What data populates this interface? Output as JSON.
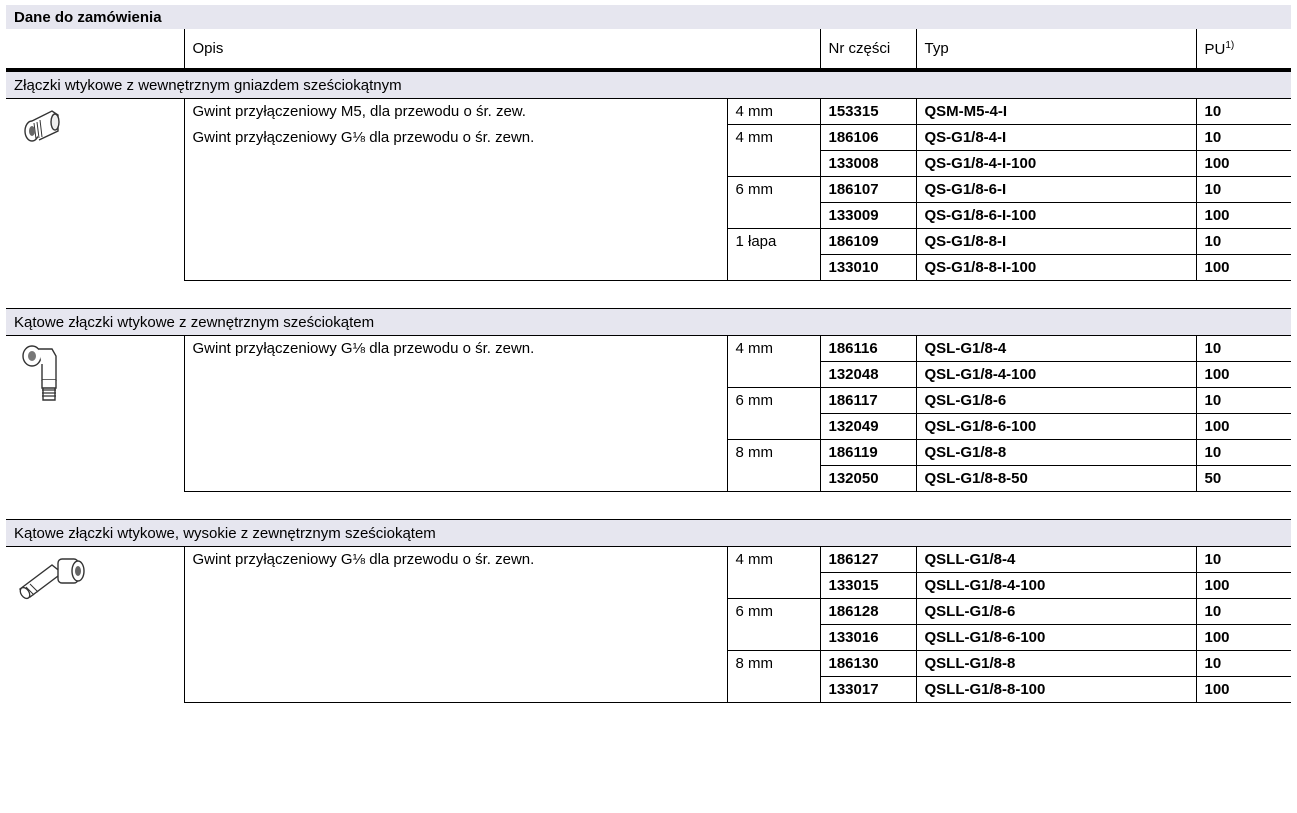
{
  "title": "Dane do zamówienia",
  "headers": {
    "opis": "Opis",
    "nr_czesci": "Nr części",
    "typ": "Typ",
    "pu": "PU",
    "pu_sup": "1)"
  },
  "sections": [
    {
      "name": "Złączki wtykowe z wewnętrznym gniazdem sześciokątnym",
      "icon": "straight-fitting-icon",
      "rows": [
        {
          "desc": "Gwint przyłączeniowy M5, dla przewodu o śr. zew.",
          "size": "4 mm",
          "part": "153315",
          "type": "QSM-M5-4-I",
          "pu": "10"
        },
        {
          "desc": "Gwint przyłączeniowy G⅛ dla przewodu o śr. zewn.",
          "size": "4 mm",
          "part": "186106",
          "type": "QS-G1/8-4-I",
          "pu": "10"
        },
        {
          "desc": "",
          "size": "",
          "part": "133008",
          "type": "QS-G1/8-4-I-100",
          "pu": "100"
        },
        {
          "desc": "",
          "size": "6 mm",
          "part": "186107",
          "type": "QS-G1/8-6-I",
          "pu": "10"
        },
        {
          "desc": "",
          "size": "",
          "part": "133009",
          "type": "QS-G1/8-6-I-100",
          "pu": "100"
        },
        {
          "desc": "",
          "size": "1 łapa",
          "part": "186109",
          "type": "QS-G1/8-8-I",
          "pu": "10"
        },
        {
          "desc": "",
          "size": "",
          "part": "133010",
          "type": "QS-G1/8-8-I-100",
          "pu": "100"
        }
      ]
    },
    {
      "name": "Kątowe złączki wtykowe z zewnętrznym sześciokątem",
      "icon": "elbow-fitting-icon",
      "rows": [
        {
          "desc": "Gwint przyłączeniowy G⅛ dla przewodu o śr. zewn.",
          "size": "4 mm",
          "part": "186116",
          "type": "QSL-G1/8-4",
          "pu": "10"
        },
        {
          "desc": "",
          "size": "",
          "part": "132048",
          "type": "QSL-G1/8-4-100",
          "pu": "100"
        },
        {
          "desc": "",
          "size": "6 mm",
          "part": "186117",
          "type": "QSL-G1/8-6",
          "pu": "10"
        },
        {
          "desc": "",
          "size": "",
          "part": "132049",
          "type": "QSL-G1/8-6-100",
          "pu": "100"
        },
        {
          "desc": "",
          "size": "8 mm",
          "part": "186119",
          "type": "QSL-G1/8-8",
          "pu": "10"
        },
        {
          "desc": "",
          "size": "",
          "part": "132050",
          "type": "QSL-G1/8-8-50",
          "pu": "50"
        }
      ]
    },
    {
      "name": "Kątowe złączki wtykowe, wysokie z zewnętrznym sześciokątem",
      "icon": "long-elbow-fitting-icon",
      "rows": [
        {
          "desc": "Gwint przyłączeniowy G⅛ dla przewodu o śr. zewn.",
          "size": "4 mm",
          "part": "186127",
          "type": "QSLL-G1/8-4",
          "pu": "10"
        },
        {
          "desc": "",
          "size": "",
          "part": "133015",
          "type": "QSLL-G1/8-4-100",
          "pu": "100"
        },
        {
          "desc": "",
          "size": "6 mm",
          "part": "186128",
          "type": "QSLL-G1/8-6",
          "pu": "10"
        },
        {
          "desc": "",
          "size": "",
          "part": "133016",
          "type": "QSLL-G1/8-6-100",
          "pu": "100"
        },
        {
          "desc": "",
          "size": "8 mm",
          "part": "186130",
          "type": "QSLL-G1/8-8",
          "pu": "10"
        },
        {
          "desc": "",
          "size": "",
          "part": "133017",
          "type": "QSLL-G1/8-8-100",
          "pu": "100"
        }
      ]
    }
  ]
}
